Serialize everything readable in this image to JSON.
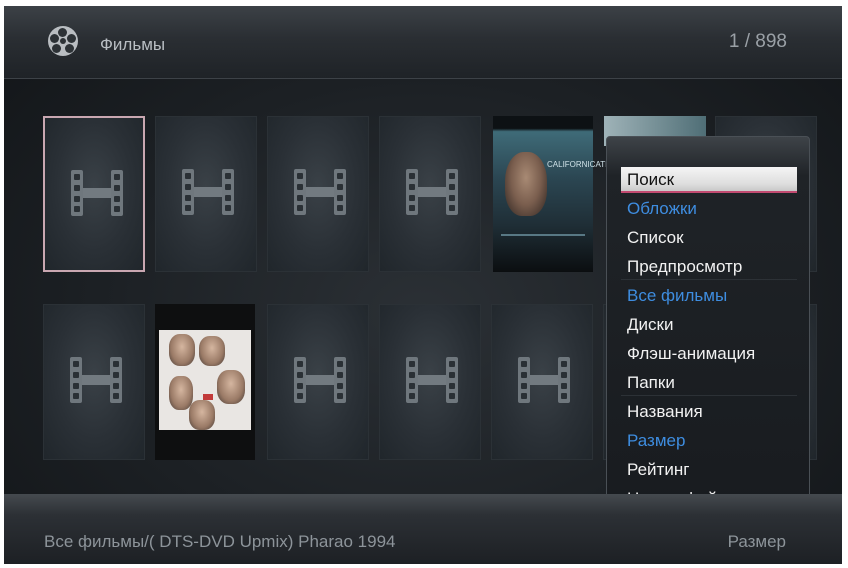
{
  "header": {
    "title": "Фильмы",
    "counter": "1 / 898",
    "icon": "film-reel-icon"
  },
  "grid": {
    "selected_index": 0,
    "rows": [
      [
        "placeholder",
        "placeholder",
        "placeholder",
        "placeholder",
        "poster",
        "partial-poster",
        "placeholder"
      ],
      [
        "placeholder",
        "poster",
        "placeholder",
        "placeholder",
        "placeholder",
        "placeholder",
        "placeholder"
      ]
    ],
    "poster_texts": {
      "poster1_logo": "CALIFORNICATION"
    }
  },
  "menu": {
    "items": [
      {
        "label": "Поиск",
        "state": "highlighted"
      },
      {
        "label": "Обложки",
        "state": "active"
      },
      {
        "label": "Список",
        "state": "normal"
      },
      {
        "label": "Предпросмотр",
        "state": "normal"
      },
      {
        "label": "Все фильмы",
        "state": "active"
      },
      {
        "label": "Диски",
        "state": "normal"
      },
      {
        "label": "Флэш-анимация",
        "state": "normal"
      },
      {
        "label": "Папки",
        "state": "normal"
      },
      {
        "label": "Названия",
        "state": "normal"
      },
      {
        "label": "Размер",
        "state": "active"
      },
      {
        "label": "Рейтинг",
        "state": "normal"
      },
      {
        "label": "Новые файлы",
        "state": "normal"
      }
    ]
  },
  "footer": {
    "path": "Все фильмы/( DTS-DVD Upmix) Pharao 1994",
    "sort_label": "Размер"
  },
  "colors": {
    "accent_blue": "#3e8de0",
    "highlight_underline": "#c24a70",
    "background": "#1c2024"
  }
}
